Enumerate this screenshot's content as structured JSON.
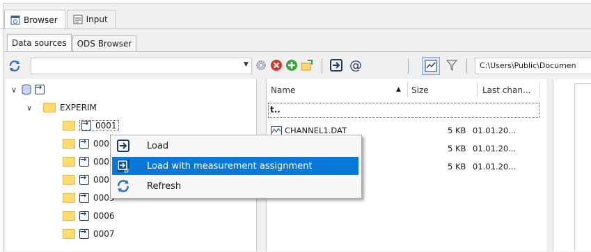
{
  "tabs": [
    {
      "label": "Browser",
      "icon": "browser-icon",
      "active": true
    },
    {
      "label": "Input",
      "icon": "input-icon",
      "active": false
    }
  ],
  "sub_tabs": [
    {
      "label": "Data sources",
      "active": true
    },
    {
      "label": "ODS Browser",
      "active": false
    }
  ],
  "toolbar": {
    "combo_value": "",
    "path": "C:\\Users\\Public\\Documen"
  },
  "tree": {
    "root_label": "",
    "folder": "EXPERIM",
    "items": [
      "0001",
      "000",
      "000",
      "000",
      "0005",
      "0006",
      "0007"
    ]
  },
  "files": {
    "columns": [
      "Name",
      "Size",
      "Last chan..."
    ],
    "up_label": "t..",
    "rows": [
      {
        "name": "CHANNEL1.DAT",
        "size": "5 KB",
        "date": "01.01.20..."
      },
      {
        "name": "",
        "size": "5 KB",
        "date": "01.01.20..."
      },
      {
        "name": "",
        "size": "5 KB",
        "date": "01.01.20..."
      }
    ]
  },
  "context_menu": {
    "items": [
      {
        "label": "Load",
        "icon": "load-icon"
      },
      {
        "label": "Load with measurement assignment",
        "icon": "load-assignment-icon"
      },
      {
        "label": "Refresh",
        "icon": "refresh-icon"
      }
    ]
  },
  "colors": {
    "highlight": "#0a78d7",
    "folder": "#ffdc73"
  }
}
